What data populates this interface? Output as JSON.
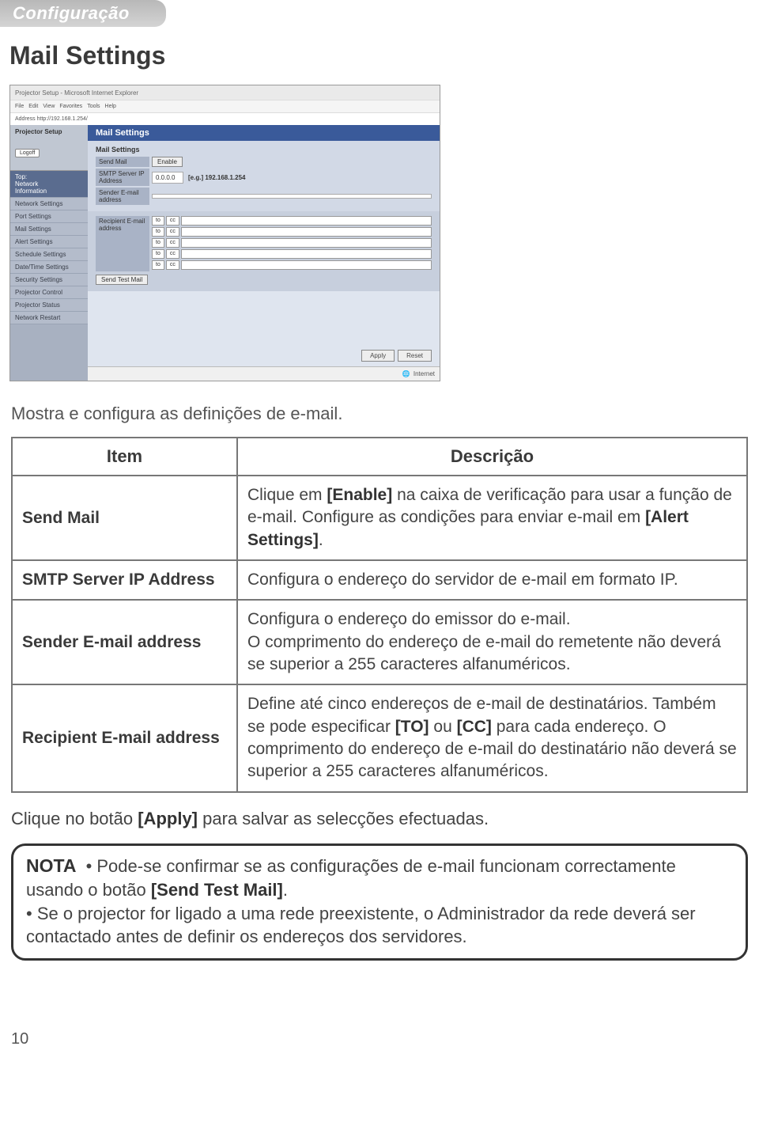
{
  "section_header": "Configuração",
  "page_title": "Mail Settings",
  "screenshot": {
    "browser_title": "Projector Setup - Microsoft Internet Explorer",
    "toolbar_items": [
      "File",
      "Edit",
      "View",
      "Favorites",
      "Tools",
      "Help"
    ],
    "address_label": "Address",
    "address_value": "http://192.168.1.254/",
    "side_top_text": "Projector Setup",
    "logoff": "Logoff",
    "side_block_label": "Top:\nNetwork\nInformation",
    "sidebar": [
      "Network Settings",
      "Port Settings",
      "Mail Settings",
      "Alert Settings",
      "Schedule Settings",
      "Date/Time Settings",
      "Security Settings",
      "Projector Control",
      "Projector Status",
      "Network Restart"
    ],
    "main_header": "Mail Settings",
    "main_sub_title": "Mail Settings",
    "rows": {
      "send_mail": "Send Mail",
      "enable": "Enable",
      "smtp_ip": "SMTP Server IP Address",
      "smtp_ip_val": "0.0.0.0",
      "smtp_ip_eg": "[e.g.] 192.168.1.254",
      "sender": "Sender E-mail address",
      "recipient": "Recipient E-mail address",
      "to": "to",
      "cc": "cc"
    },
    "send_test": "Send Test Mail",
    "apply": "Apply",
    "reset": "Reset",
    "footer": "Internet"
  },
  "intro": "Mostra e configura as definições de e-mail.",
  "table": {
    "header_item": "Item",
    "header_desc": "Descrição",
    "rows": [
      {
        "item": "Send Mail",
        "desc_pre": "Clique em ",
        "desc_bold1": "[Enable]",
        "desc_mid": " na caixa de verificação para usar a função de e-mail. Configure as condições para enviar e-mail em ",
        "desc_bold2": "[Alert Settings]",
        "desc_post": "."
      },
      {
        "item": "SMTP Server IP Address",
        "desc": "Configura o endereço do servidor de e-mail em formato IP."
      },
      {
        "item": "Sender E-mail address",
        "desc": "Configura o endereço do emissor do e-mail.\nO comprimento do endereço de e-mail do remetente não deverá se superior a 255 caracteres alfanuméricos."
      },
      {
        "item": "Recipient E-mail address",
        "desc_pre": "Define até cinco endereços de e-mail de destinatários. Também se pode especificar ",
        "desc_bold1": "[TO]",
        "desc_mid1": " ou ",
        "desc_bold2": "[CC]",
        "desc_post": " para cada endereço. O comprimento do endereço de e-mail do destinatário não deverá se superior a 255 caracteres alfanuméricos."
      }
    ]
  },
  "apply_line_pre": "Clique no botão ",
  "apply_line_bold": "[Apply]",
  "apply_line_post": " para salvar as selecções efectuadas.",
  "nota": {
    "label": "NOTA",
    "l1_pre": " • Pode-se confirmar se as configurações de e-mail funcionam correctamente usando o botão ",
    "l1_bold": "[Send Test Mail]",
    "l1_post": ".",
    "l2": "• Se o projector for ligado a uma rede preexistente, o Administrador da rede deverá ser contactado antes de definir os endereços dos servidores."
  },
  "page_number": "10"
}
